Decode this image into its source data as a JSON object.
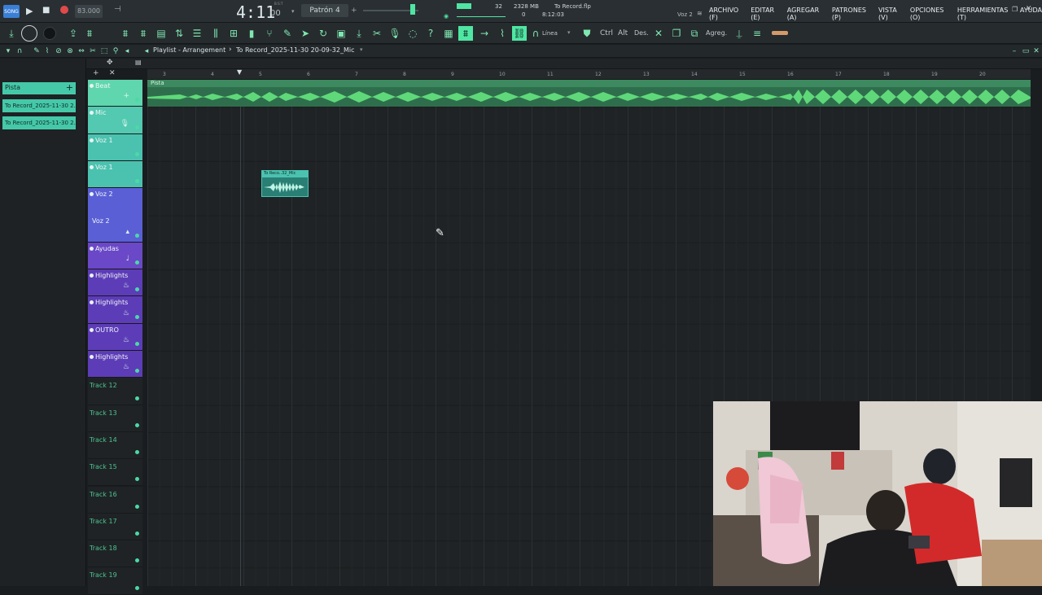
{
  "transport": {
    "mode_label": "SONG",
    "tempo": "83.000",
    "time": "4:11",
    "time_small": "00",
    "time_unit": "B:S:T",
    "pattern": "Patrón 4",
    "cpu_value": "32",
    "memory": "2328 MB",
    "poly": "0",
    "project_time": "8:12:03",
    "project_file": "To Record.flp",
    "hint": "Voz 2"
  },
  "menu": {
    "items": [
      "ARCHIVO (F)",
      "EDITAR (E)",
      "AGREGAR (A)",
      "PATRONES (P)",
      "VISTA (V)",
      "OPCIONES (O)",
      "HERRAMIENTAS (T)",
      "AYUDA"
    ]
  },
  "toolbar": {
    "snap_label": "Línea",
    "ctrl_label": "Ctrl",
    "alt_label": "Alt",
    "des_label": "Des.",
    "agreg_label": "Agreg."
  },
  "playlist": {
    "title": "Playlist - Arrangement",
    "arrow": "›",
    "pattern_name": "To Record_2025-11-30 20-09-32_Mic",
    "ruler_numbers": [
      "3",
      "4",
      "5",
      "6",
      "7",
      "8",
      "9",
      "10",
      "11",
      "12",
      "13",
      "14",
      "15",
      "16",
      "17",
      "18",
      "19",
      "20"
    ],
    "track_label_beat": "Pista",
    "clip_label": "To Reco..32_Mic"
  },
  "browser": {
    "header": "Pista",
    "patterns": [
      "To Record_2025-11-30 2...",
      "To Record_2025-11-30 2..."
    ]
  },
  "tracks": [
    {
      "name": "Beat",
      "color": "#5fd6ae",
      "icon": "plus-icon"
    },
    {
      "name": "Mic",
      "color": "#52c9b0",
      "icon": "mic-icon"
    },
    {
      "name": "Voz 1",
      "color": "#4bc2b0",
      "icon": ""
    },
    {
      "name": "Voz 1",
      "color": "#4bc2b0",
      "icon": ""
    },
    {
      "name": "Voz 2",
      "color": "#5a5fd6",
      "icon": "chevron-icon",
      "sub": "Voz 2"
    },
    {
      "name": "Ayudas",
      "color": "#6b48c8",
      "icon": "note-icon"
    },
    {
      "name": "Highlights",
      "color": "#5d3cb8",
      "icon": "fire-icon"
    },
    {
      "name": "Highlights",
      "color": "#5d3cb8",
      "icon": "fire-icon"
    },
    {
      "name": "OUTRO",
      "color": "#5d3cb8",
      "icon": "fire-icon"
    },
    {
      "name": "Highlights",
      "color": "#5d3cb8",
      "icon": "fire-icon"
    },
    {
      "name": "Track 12"
    },
    {
      "name": "Track 13"
    },
    {
      "name": "Track 14"
    },
    {
      "name": "Track 15"
    },
    {
      "name": "Track 16"
    },
    {
      "name": "Track 17"
    },
    {
      "name": "Track 18"
    },
    {
      "name": "Track 19"
    }
  ],
  "colors": {
    "accent": "#4fe6a3",
    "audio_wave": "#5fd87a",
    "clip": "#4bc2b0",
    "record": "#e04a4a"
  }
}
